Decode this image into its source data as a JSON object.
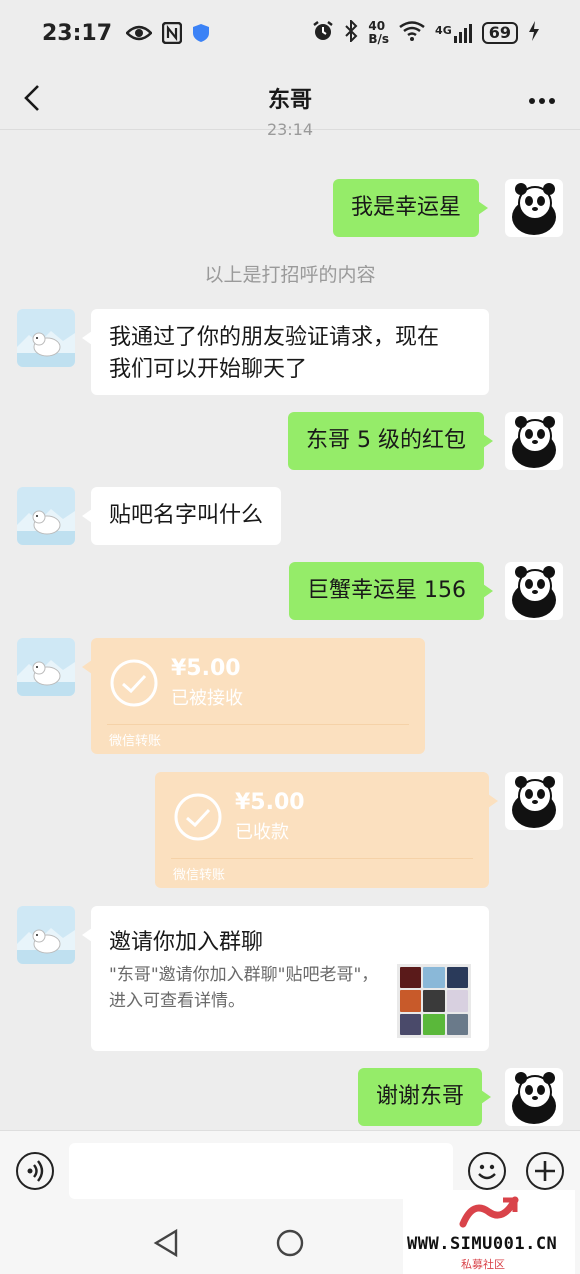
{
  "status_bar": {
    "time": "23:17",
    "net_speed_top": "40",
    "net_speed_bottom": "B/s",
    "signal_label": "4G",
    "wifi_label": "6",
    "battery": "69"
  },
  "header": {
    "title": "东哥"
  },
  "chat": {
    "timestamp": "23:14",
    "system_note": "以上是打招呼的内容",
    "messages": [
      {
        "text": "我是幸运星"
      },
      {
        "text_line1": "我通过了你的朋友验证请求，现在",
        "text_line2": "我们可以开始聊天了"
      },
      {
        "text": "东哥 5 级的红包"
      },
      {
        "text": "贴吧名字叫什么"
      },
      {
        "text": "巨蟹幸运星 156"
      },
      {
        "amount": "¥5.00",
        "status": "已被接收",
        "brand": "微信转账"
      },
      {
        "amount": "¥5.00",
        "status": "已收款",
        "brand": "微信转账"
      },
      {
        "title": "邀请你加入群聊",
        "desc": "\"东哥\"邀请你加入群聊\"贴吧老哥\"，进入可查看详情。"
      },
      {
        "text": "谢谢东哥"
      }
    ]
  },
  "invite_grid_colors": [
    "#5a1a1a",
    "#8ab8d8",
    "#2a3a5a",
    "#c85a2a",
    "#3a3a3a",
    "#d8d0e0",
    "#4a4a6a",
    "#5ab83a",
    "#6a7a8a"
  ],
  "colors": {
    "my_bubble": "#95ec69",
    "other_bubble": "#ffffff",
    "transfer": "#fbe0bf",
    "background": "#ededed"
  },
  "watermark": {
    "text": "WWW.SIMU001.CN",
    "sub": "私募社区"
  }
}
